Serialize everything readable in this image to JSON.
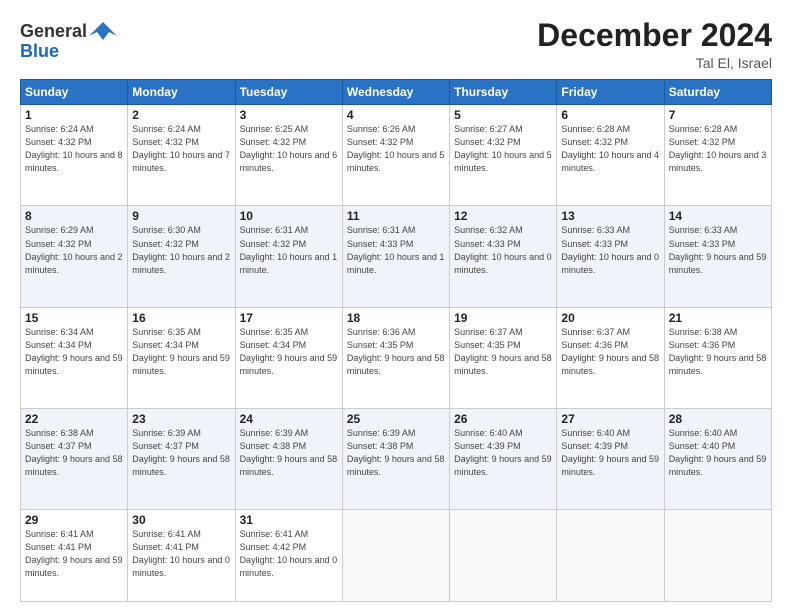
{
  "header": {
    "logo_general": "General",
    "logo_blue": "Blue",
    "month_year": "December 2024",
    "location": "Tal El, Israel"
  },
  "days_of_week": [
    "Sunday",
    "Monday",
    "Tuesday",
    "Wednesday",
    "Thursday",
    "Friday",
    "Saturday"
  ],
  "weeks": [
    [
      {
        "day": 1,
        "sunrise": "6:24 AM",
        "sunset": "4:32 PM",
        "daylight": "10 hours and 8 minutes."
      },
      {
        "day": 2,
        "sunrise": "6:24 AM",
        "sunset": "4:32 PM",
        "daylight": "10 hours and 7 minutes."
      },
      {
        "day": 3,
        "sunrise": "6:25 AM",
        "sunset": "4:32 PM",
        "daylight": "10 hours and 6 minutes."
      },
      {
        "day": 4,
        "sunrise": "6:26 AM",
        "sunset": "4:32 PM",
        "daylight": "10 hours and 5 minutes."
      },
      {
        "day": 5,
        "sunrise": "6:27 AM",
        "sunset": "4:32 PM",
        "daylight": "10 hours and 5 minutes."
      },
      {
        "day": 6,
        "sunrise": "6:28 AM",
        "sunset": "4:32 PM",
        "daylight": "10 hours and 4 minutes."
      },
      {
        "day": 7,
        "sunrise": "6:28 AM",
        "sunset": "4:32 PM",
        "daylight": "10 hours and 3 minutes."
      }
    ],
    [
      {
        "day": 8,
        "sunrise": "6:29 AM",
        "sunset": "4:32 PM",
        "daylight": "10 hours and 2 minutes."
      },
      {
        "day": 9,
        "sunrise": "6:30 AM",
        "sunset": "4:32 PM",
        "daylight": "10 hours and 2 minutes."
      },
      {
        "day": 10,
        "sunrise": "6:31 AM",
        "sunset": "4:32 PM",
        "daylight": "10 hours and 1 minute."
      },
      {
        "day": 11,
        "sunrise": "6:31 AM",
        "sunset": "4:33 PM",
        "daylight": "10 hours and 1 minute."
      },
      {
        "day": 12,
        "sunrise": "6:32 AM",
        "sunset": "4:33 PM",
        "daylight": "10 hours and 0 minutes."
      },
      {
        "day": 13,
        "sunrise": "6:33 AM",
        "sunset": "4:33 PM",
        "daylight": "10 hours and 0 minutes."
      },
      {
        "day": 14,
        "sunrise": "6:33 AM",
        "sunset": "4:33 PM",
        "daylight": "9 hours and 59 minutes."
      }
    ],
    [
      {
        "day": 15,
        "sunrise": "6:34 AM",
        "sunset": "4:34 PM",
        "daylight": "9 hours and 59 minutes."
      },
      {
        "day": 16,
        "sunrise": "6:35 AM",
        "sunset": "4:34 PM",
        "daylight": "9 hours and 59 minutes."
      },
      {
        "day": 17,
        "sunrise": "6:35 AM",
        "sunset": "4:34 PM",
        "daylight": "9 hours and 59 minutes."
      },
      {
        "day": 18,
        "sunrise": "6:36 AM",
        "sunset": "4:35 PM",
        "daylight": "9 hours and 58 minutes."
      },
      {
        "day": 19,
        "sunrise": "6:37 AM",
        "sunset": "4:35 PM",
        "daylight": "9 hours and 58 minutes."
      },
      {
        "day": 20,
        "sunrise": "6:37 AM",
        "sunset": "4:36 PM",
        "daylight": "9 hours and 58 minutes."
      },
      {
        "day": 21,
        "sunrise": "6:38 AM",
        "sunset": "4:36 PM",
        "daylight": "9 hours and 58 minutes."
      }
    ],
    [
      {
        "day": 22,
        "sunrise": "6:38 AM",
        "sunset": "4:37 PM",
        "daylight": "9 hours and 58 minutes."
      },
      {
        "day": 23,
        "sunrise": "6:39 AM",
        "sunset": "4:37 PM",
        "daylight": "9 hours and 58 minutes."
      },
      {
        "day": 24,
        "sunrise": "6:39 AM",
        "sunset": "4:38 PM",
        "daylight": "9 hours and 58 minutes."
      },
      {
        "day": 25,
        "sunrise": "6:39 AM",
        "sunset": "4:38 PM",
        "daylight": "9 hours and 58 minutes."
      },
      {
        "day": 26,
        "sunrise": "6:40 AM",
        "sunset": "4:39 PM",
        "daylight": "9 hours and 59 minutes."
      },
      {
        "day": 27,
        "sunrise": "6:40 AM",
        "sunset": "4:39 PM",
        "daylight": "9 hours and 59 minutes."
      },
      {
        "day": 28,
        "sunrise": "6:40 AM",
        "sunset": "4:40 PM",
        "daylight": "9 hours and 59 minutes."
      }
    ],
    [
      {
        "day": 29,
        "sunrise": "6:41 AM",
        "sunset": "4:41 PM",
        "daylight": "9 hours and 59 minutes."
      },
      {
        "day": 30,
        "sunrise": "6:41 AM",
        "sunset": "4:41 PM",
        "daylight": "10 hours and 0 minutes."
      },
      {
        "day": 31,
        "sunrise": "6:41 AM",
        "sunset": "4:42 PM",
        "daylight": "10 hours and 0 minutes."
      },
      null,
      null,
      null,
      null
    ]
  ]
}
